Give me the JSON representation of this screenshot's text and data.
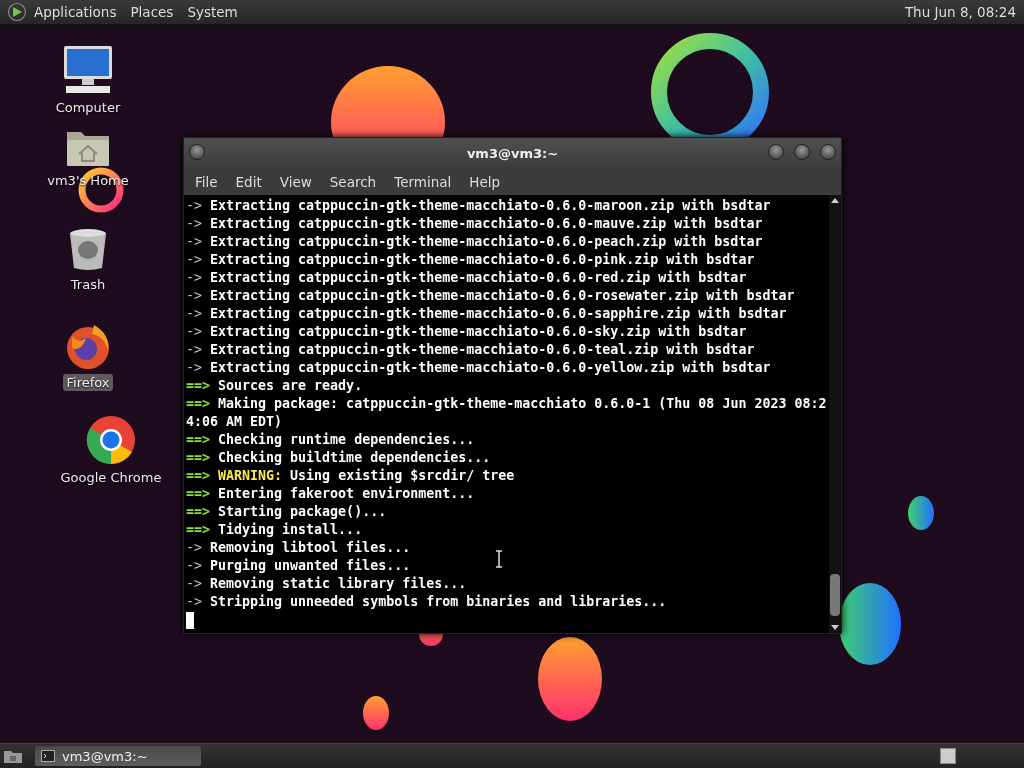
{
  "top_panel": {
    "menus": [
      {
        "label": "Applications"
      },
      {
        "label": "Places"
      },
      {
        "label": "System"
      }
    ],
    "clock": "Thu Jun 8, 08:24"
  },
  "desktop_icons": [
    {
      "kind": "computer",
      "label": "Computer",
      "selected": false
    },
    {
      "kind": "home",
      "label": "vm3's Home",
      "selected": false
    },
    {
      "kind": "trash",
      "label": "Trash",
      "selected": false
    },
    {
      "kind": "firefox",
      "label": "Firefox",
      "selected": true
    },
    {
      "kind": "chrome",
      "label": "Google Chrome",
      "selected": false
    }
  ],
  "terminal": {
    "title": "vm3@vm3:~",
    "menu": [
      "File",
      "Edit",
      "View",
      "Search",
      "Terminal",
      "Help"
    ],
    "lines": [
      {
        "kind": "sub",
        "prefix": "->",
        "text": "Extracting catppuccin-gtk-theme-macchiato-0.6.0-maroon.zip with bsdtar"
      },
      {
        "kind": "sub",
        "prefix": "->",
        "text": "Extracting catppuccin-gtk-theme-macchiato-0.6.0-mauve.zip with bsdtar"
      },
      {
        "kind": "sub",
        "prefix": "->",
        "text": "Extracting catppuccin-gtk-theme-macchiato-0.6.0-peach.zip with bsdtar"
      },
      {
        "kind": "sub",
        "prefix": "->",
        "text": "Extracting catppuccin-gtk-theme-macchiato-0.6.0-pink.zip with bsdtar"
      },
      {
        "kind": "sub",
        "prefix": "->",
        "text": "Extracting catppuccin-gtk-theme-macchiato-0.6.0-red.zip with bsdtar"
      },
      {
        "kind": "sub",
        "prefix": "->",
        "text": "Extracting catppuccin-gtk-theme-macchiato-0.6.0-rosewater.zip with bsdtar"
      },
      {
        "kind": "sub",
        "prefix": "->",
        "text": "Extracting catppuccin-gtk-theme-macchiato-0.6.0-sapphire.zip with bsdtar"
      },
      {
        "kind": "sub",
        "prefix": "->",
        "text": "Extracting catppuccin-gtk-theme-macchiato-0.6.0-sky.zip with bsdtar"
      },
      {
        "kind": "sub",
        "prefix": "->",
        "text": "Extracting catppuccin-gtk-theme-macchiato-0.6.0-teal.zip with bsdtar"
      },
      {
        "kind": "sub",
        "prefix": "->",
        "text": "Extracting catppuccin-gtk-theme-macchiato-0.6.0-yellow.zip with bsdtar"
      },
      {
        "kind": "main",
        "prefix": "==>",
        "text": "Sources are ready."
      },
      {
        "kind": "main",
        "prefix": "==>",
        "text": "Making package: catppuccin-gtk-theme-macchiato 0.6.0-1 (Thu 08 Jun 2023 08:2"
      },
      {
        "kind": "plain",
        "text": "4:06 AM EDT)"
      },
      {
        "kind": "main",
        "prefix": "==>",
        "text": "Checking runtime dependencies..."
      },
      {
        "kind": "main",
        "prefix": "==>",
        "text": "Checking buildtime dependencies..."
      },
      {
        "kind": "warning",
        "prefix": "==>",
        "label": "WARNING:",
        "text": "Using existing $srcdir/ tree"
      },
      {
        "kind": "main",
        "prefix": "==>",
        "text": "Entering fakeroot environment..."
      },
      {
        "kind": "main",
        "prefix": "==>",
        "text": "Starting package()..."
      },
      {
        "kind": "main",
        "prefix": "==>",
        "text": "Tidying install..."
      },
      {
        "kind": "sub",
        "prefix": "->",
        "text": "Removing libtool files..."
      },
      {
        "kind": "sub",
        "prefix": "->",
        "text": "Purging unwanted files..."
      },
      {
        "kind": "sub",
        "prefix": "->",
        "text": "Removing static library files..."
      },
      {
        "kind": "sub",
        "prefix": "->",
        "text": "Stripping unneeded symbols from binaries and libraries..."
      }
    ]
  },
  "taskbar": {
    "tasks": [
      {
        "label": "vm3@vm3:~"
      }
    ]
  }
}
